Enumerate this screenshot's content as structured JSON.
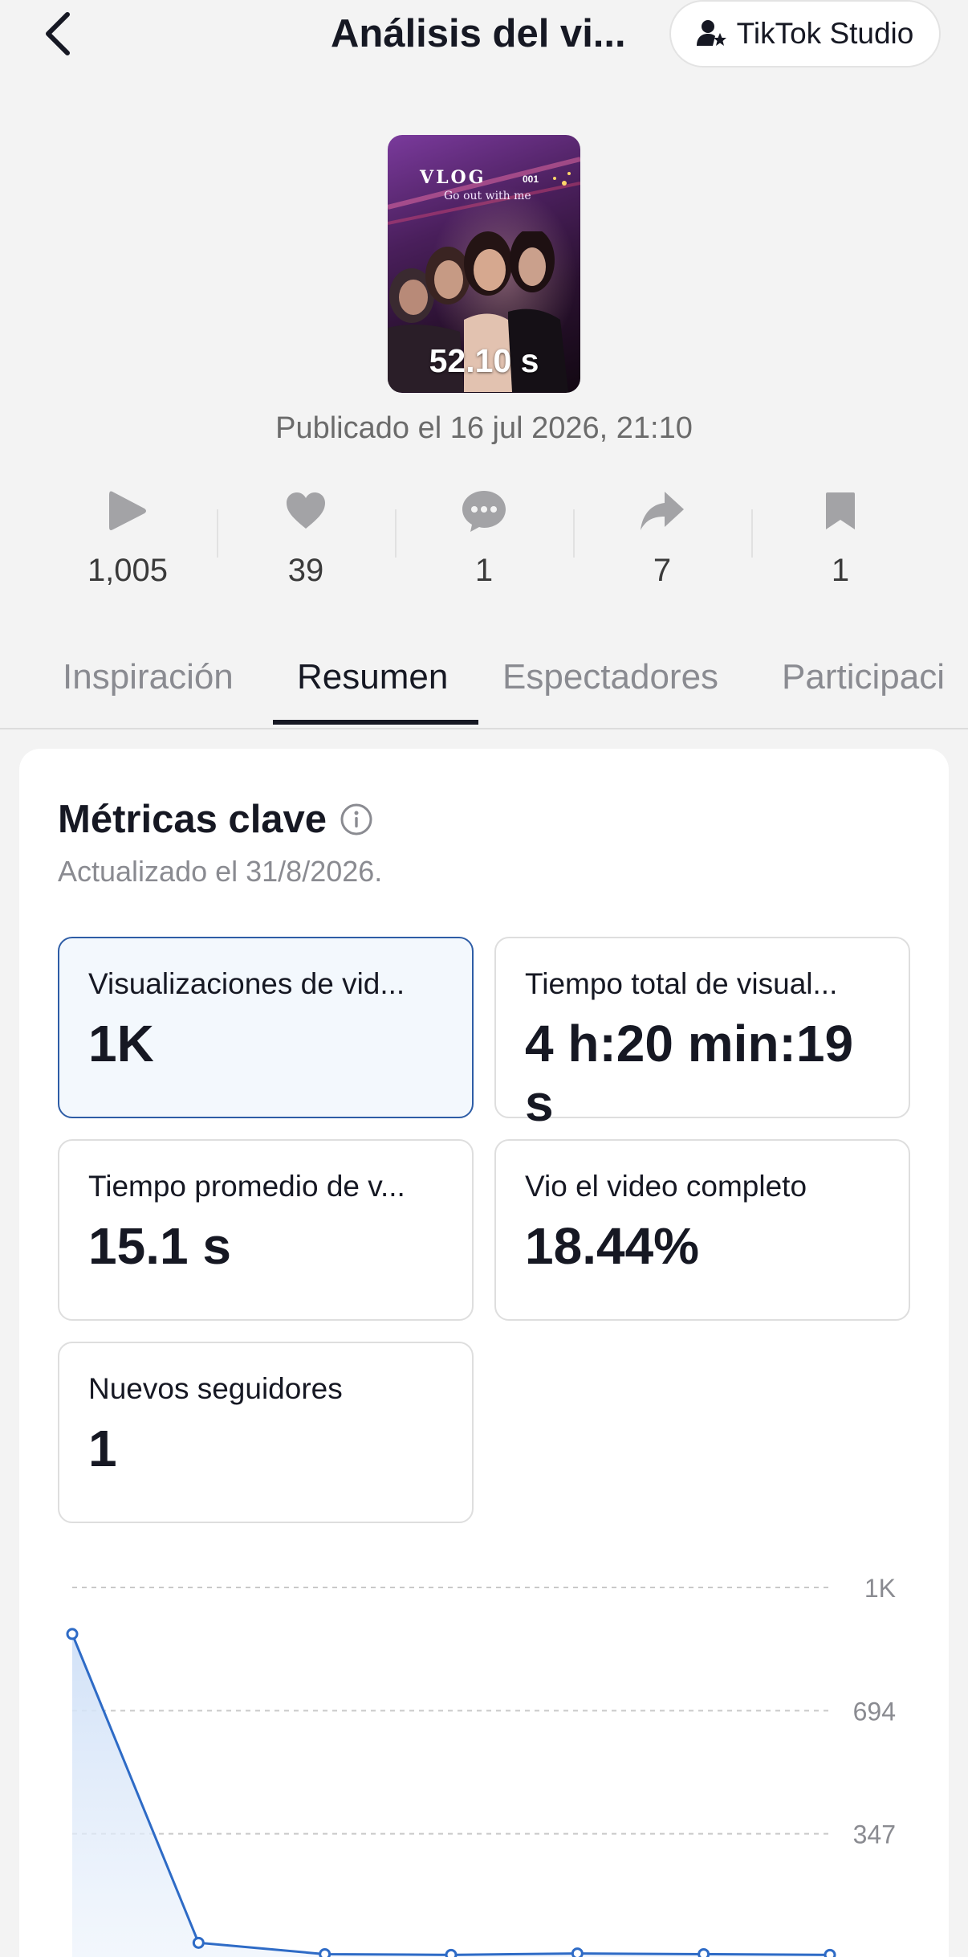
{
  "header": {
    "title": "Análisis del vi...",
    "studio_button": "TikTok Studio"
  },
  "video": {
    "duration": "52.10 s",
    "overlay_title": "VLOG",
    "overlay_number": "001",
    "overlay_subtitle": "Go out with me",
    "published": "Publicado el 16 jul 2026, 21:10"
  },
  "stats": [
    {
      "icon": "play-icon",
      "value": "1,005"
    },
    {
      "icon": "heart-icon",
      "value": "39"
    },
    {
      "icon": "comment-icon",
      "value": "1"
    },
    {
      "icon": "share-icon",
      "value": "7"
    },
    {
      "icon": "bookmark-icon",
      "value": "1"
    }
  ],
  "tabs": [
    "Inspiración",
    "Resumen",
    "Espectadores",
    "Participaci"
  ],
  "active_tab": "Resumen",
  "key_metrics": {
    "title": "Métricas clave",
    "updated": "Actualizado el 31/8/2026.",
    "cards": [
      {
        "label": "Visualizaciones de vid...",
        "value": "1K"
      },
      {
        "label": "Tiempo total de visual...",
        "value": "4 h:20 min:19 s"
      },
      {
        "label": "Tiempo promedio de v...",
        "value": "15.1 s"
      },
      {
        "label": "Vio el video completo",
        "value": "18.44%"
      },
      {
        "label": "Nuevos seguidores",
        "value": "1"
      }
    ]
  },
  "chart_data": {
    "type": "area",
    "y_tick_labels": [
      "1K",
      "694",
      "347"
    ],
    "y_ticks": [
      1041,
      694,
      347
    ],
    "ylim": [
      0,
      1041
    ],
    "series": [
      {
        "values": [
          910,
          40,
          8,
          6,
          10,
          8,
          6
        ]
      }
    ],
    "line_color": "#2e6bc6",
    "grid": true
  }
}
